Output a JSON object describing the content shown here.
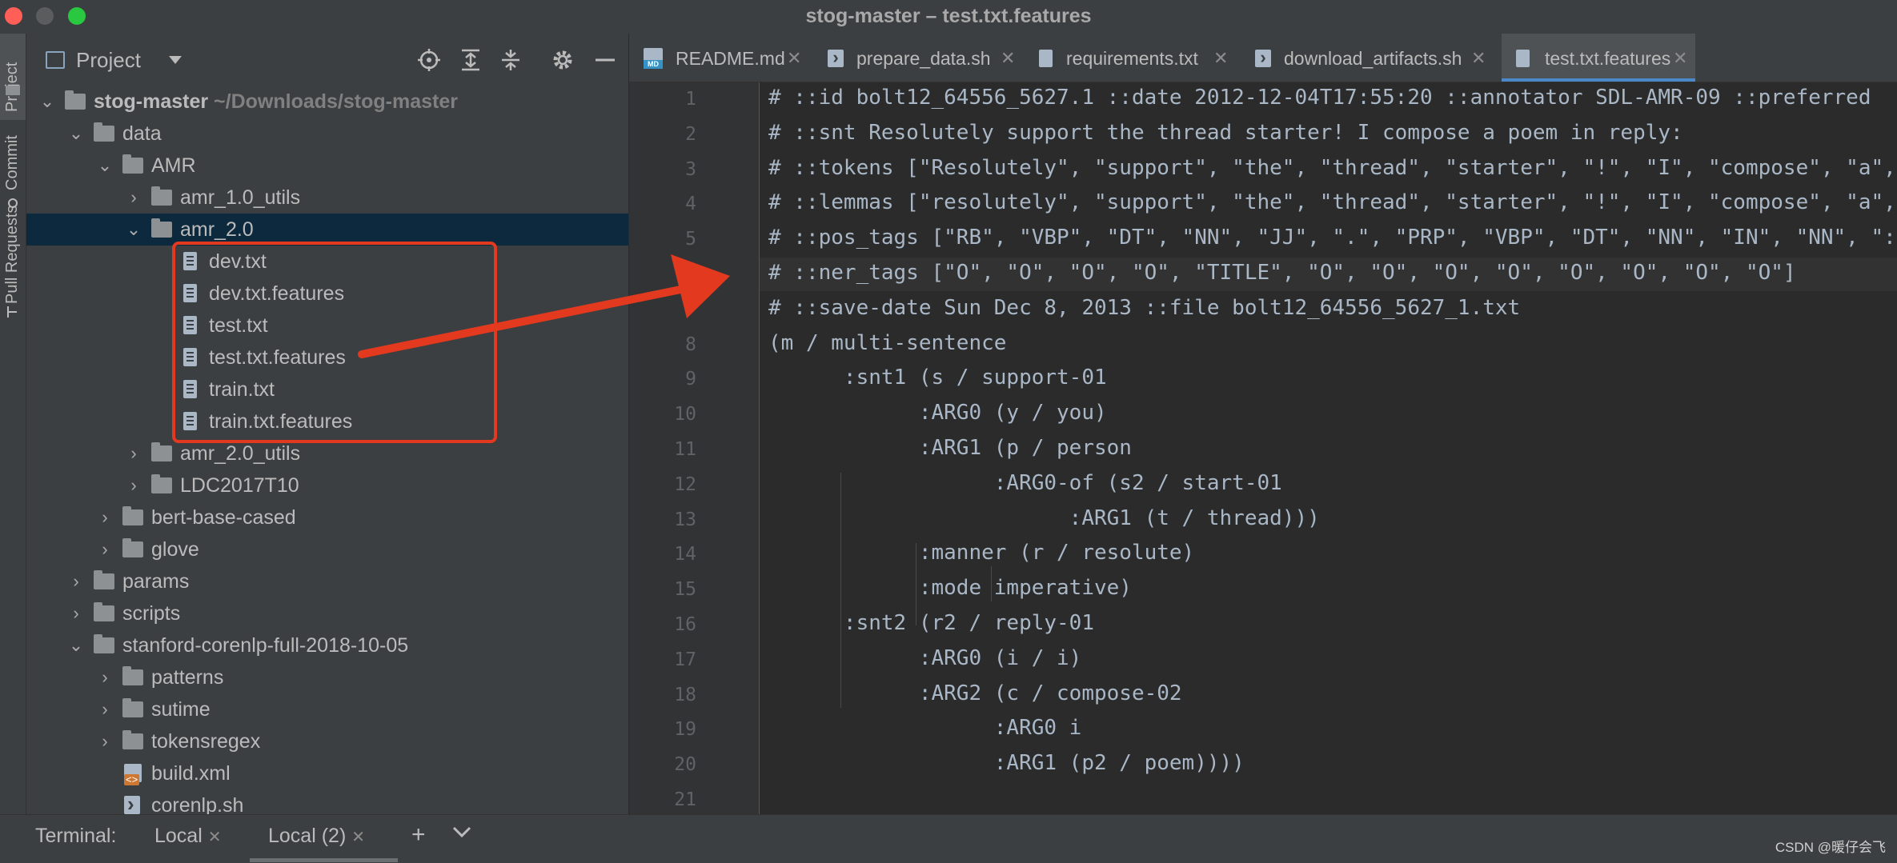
{
  "window": {
    "title": "stog-master – test.txt.features"
  },
  "left_strip": {
    "tabs": [
      "Project",
      "Commit",
      "Pull Requests"
    ]
  },
  "project_panel": {
    "title": "Project",
    "tree": [
      {
        "name": "stog-master",
        "path": "~/Downloads/stog-master",
        "type": "folder",
        "expanded": true,
        "level": 0,
        "bold": true
      },
      {
        "name": "data",
        "type": "folder",
        "expanded": true,
        "level": 1
      },
      {
        "name": "AMR",
        "type": "folder",
        "expanded": true,
        "level": 2
      },
      {
        "name": "amr_1.0_utils",
        "type": "folder",
        "expanded": false,
        "level": 3
      },
      {
        "name": "amr_2.0",
        "type": "folder",
        "expanded": true,
        "level": 3,
        "selected": true
      },
      {
        "name": "dev.txt",
        "type": "file",
        "level": 4
      },
      {
        "name": "dev.txt.features",
        "type": "file",
        "level": 4
      },
      {
        "name": "test.txt",
        "type": "file",
        "level": 4
      },
      {
        "name": "test.txt.features",
        "type": "file",
        "level": 4
      },
      {
        "name": "train.txt",
        "type": "file",
        "level": 4
      },
      {
        "name": "train.txt.features",
        "type": "file",
        "level": 4
      },
      {
        "name": "amr_2.0_utils",
        "type": "folder",
        "expanded": false,
        "level": 3
      },
      {
        "name": "LDC2017T10",
        "type": "folder",
        "expanded": false,
        "level": 3
      },
      {
        "name": "bert-base-cased",
        "type": "folder",
        "expanded": false,
        "level": 2
      },
      {
        "name": "glove",
        "type": "folder",
        "expanded": false,
        "level": 2
      },
      {
        "name": "params",
        "type": "folder",
        "expanded": false,
        "level": 1
      },
      {
        "name": "scripts",
        "type": "folder",
        "expanded": false,
        "level": 1
      },
      {
        "name": "stanford-corenlp-full-2018-10-05",
        "type": "folder",
        "expanded": true,
        "level": 1
      },
      {
        "name": "patterns",
        "type": "folder",
        "expanded": false,
        "level": 2
      },
      {
        "name": "sutime",
        "type": "folder",
        "expanded": false,
        "level": 2
      },
      {
        "name": "tokensregex",
        "type": "folder",
        "expanded": false,
        "level": 2
      },
      {
        "name": "build.xml",
        "type": "xml",
        "level": 2
      },
      {
        "name": "corenlp.sh",
        "type": "sh",
        "level": 2
      }
    ]
  },
  "tabs": [
    {
      "label": "README.md",
      "icon": "markdown-icon",
      "active": false
    },
    {
      "label": "prepare_data.sh",
      "icon": "shell-icon",
      "active": false
    },
    {
      "label": "requirements.txt",
      "icon": "text-file-icon",
      "active": false
    },
    {
      "label": "download_artifacts.sh",
      "icon": "shell-icon",
      "active": false
    },
    {
      "label": "test.txt.features",
      "icon": "text-file-icon",
      "active": true
    }
  ],
  "editor": {
    "lines": [
      "# ::id bolt12_64556_5627.1 ::date 2012-12-04T17:55:20 ::annotator SDL-AMR-09 ::preferred",
      "# ::snt Resolutely support the thread starter! I compose a poem in reply:",
      "# ::tokens [\"Resolutely\", \"support\", \"the\", \"thread\", \"starter\", \"!\", \"I\", \"compose\", \"a\",",
      "# ::lemmas [\"resolutely\", \"support\", \"the\", \"thread\", \"starter\", \"!\", \"I\", \"compose\", \"a\",",
      "# ::pos_tags [\"RB\", \"VBP\", \"DT\", \"NN\", \"JJ\", \".\", \"PRP\", \"VBP\", \"DT\", \"NN\", \"IN\", \"NN\", \":\"",
      "# ::ner_tags [\"O\", \"O\", \"O\", \"O\", \"TITLE\", \"O\", \"O\", \"O\", \"O\", \"O\", \"O\", \"O\", \"O\"]",
      "# ::save-date Sun Dec 8, 2013 ::file bolt12_64556_5627_1.txt",
      "(m / multi-sentence",
      "      :snt1 (s / support-01",
      "            :ARG0 (y / you)",
      "            :ARG1 (p / person",
      "                  :ARG0-of (s2 / start-01",
      "                        :ARG1 (t / thread)))",
      "            :manner (r / resolute)",
      "            :mode imperative)",
      "      :snt2 (r2 / reply-01",
      "            :ARG0 (i / i)",
      "            :ARG2 (c / compose-02",
      "                  :ARG0 i",
      "                  :ARG1 (p2 / poem))))",
      ""
    ],
    "line_numbers": [
      "1",
      "2",
      "3",
      "4",
      "5",
      "6",
      "7",
      "8",
      "9",
      "10",
      "11",
      "12",
      "13",
      "14",
      "15",
      "16",
      "17",
      "18",
      "19",
      "20",
      "21"
    ]
  },
  "bottom": {
    "terminal_label": "Terminal:",
    "tabs": [
      "Local",
      "Local (2)"
    ],
    "add": "+",
    "dropdown": "⌄"
  },
  "watermark": "CSDN @暖仔会飞",
  "colors": {
    "annotation": "#e2391f",
    "selection": "#0d293e",
    "tab_underline": "#4a88c7"
  }
}
